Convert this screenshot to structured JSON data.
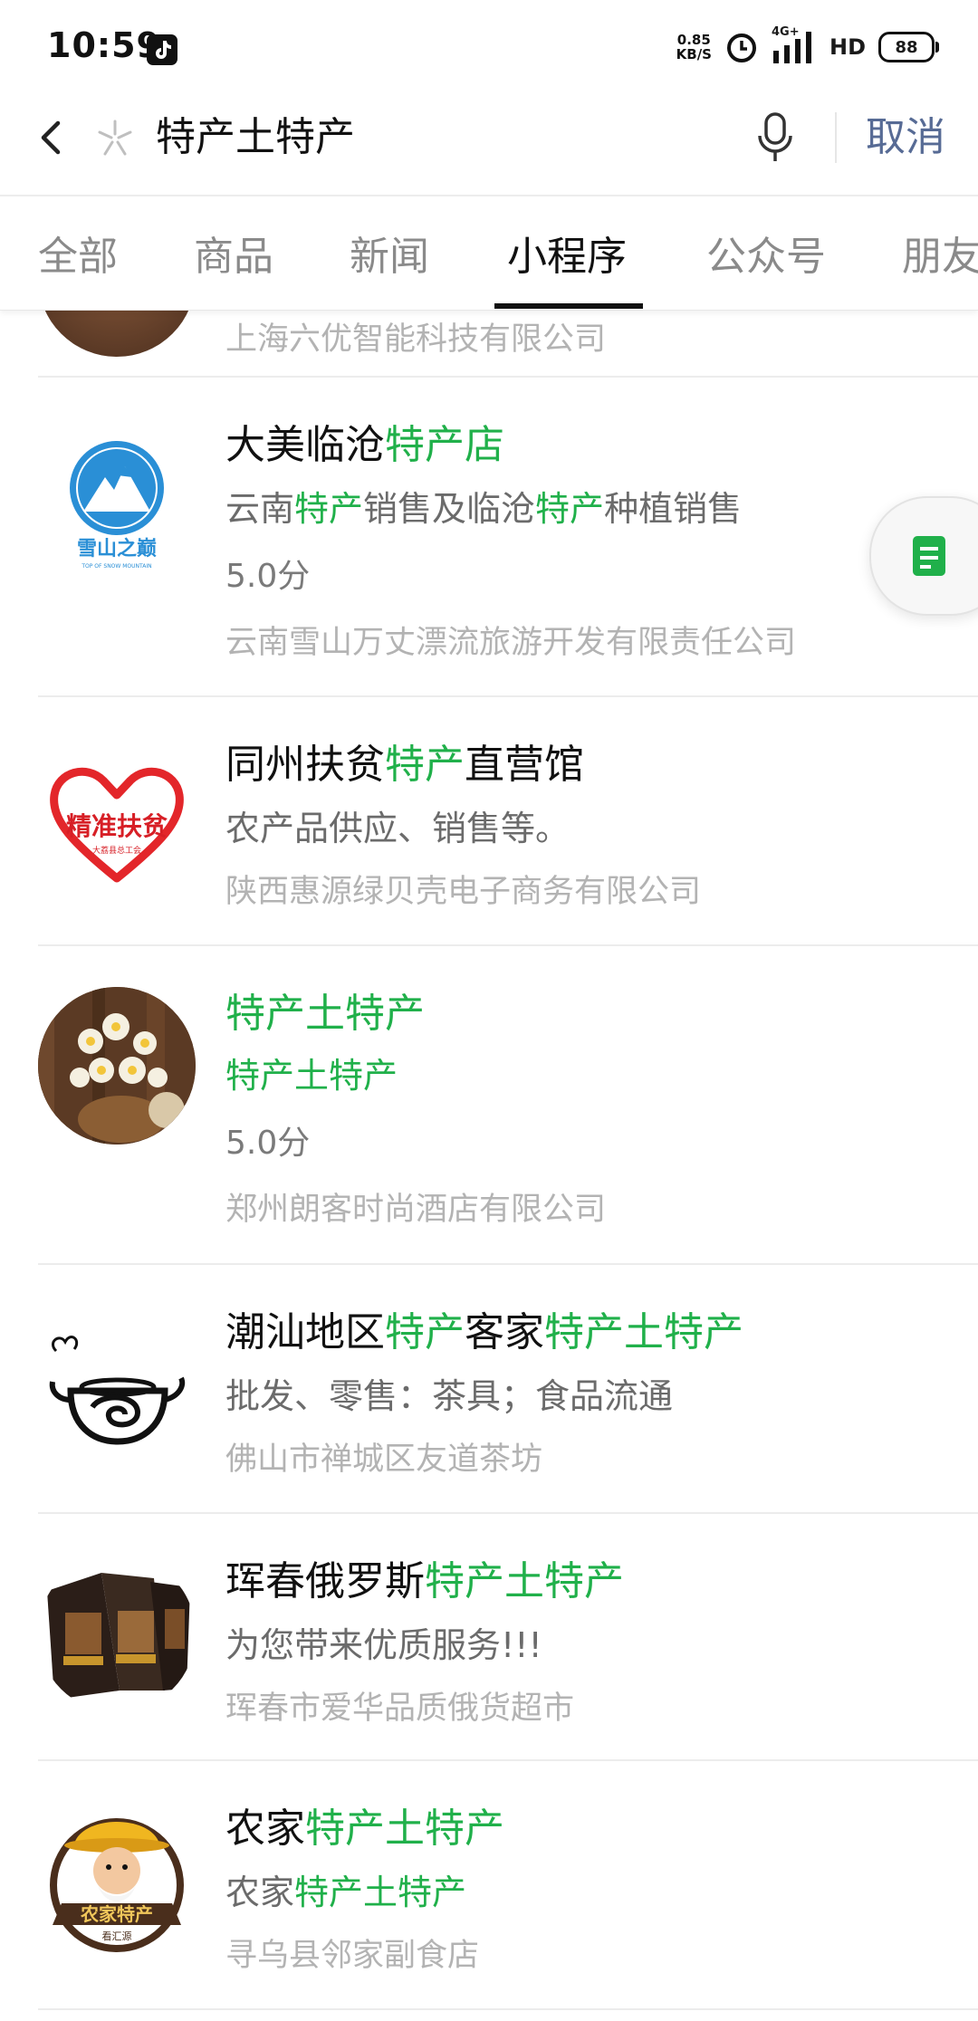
{
  "status_bar": {
    "time": "10:59",
    "net_speed_value": "0.85",
    "net_speed_unit": "KB/S",
    "network": "4G+",
    "hd": "HD",
    "battery": "88"
  },
  "search": {
    "query": "特产土特产",
    "cancel_label": "取消"
  },
  "tabs": [
    {
      "label": "全部"
    },
    {
      "label": "商品"
    },
    {
      "label": "新闻"
    },
    {
      "label": "小程序",
      "active": true
    },
    {
      "label": "公众号"
    },
    {
      "label": "朋友"
    }
  ],
  "results": [
    {
      "company": "上海六优智能科技有限公司"
    },
    {
      "title": [
        "大美临沧",
        "特产店"
      ],
      "desc": [
        "云南",
        "特产",
        "销售及临沧",
        "特产",
        "种植销售"
      ],
      "score": "5.0分",
      "company": "云南雪山万丈漂流旅游开发有限责任公司",
      "logo_text": "雪山之巅",
      "logo_subtext": "TOP OF SNOW MOUNTAIN"
    },
    {
      "title": [
        "同州扶贫",
        "特产",
        "直营馆"
      ],
      "desc": [
        "农产品供应、销售等。"
      ],
      "company": "陕西惠源绿贝壳电子商务有限公司",
      "logo_text": "精准扶贫",
      "logo_subtext": "大荔县总工会"
    },
    {
      "title": [
        "特产土特产"
      ],
      "desc": [
        "特产土特产"
      ],
      "score": "5.0分",
      "company": "郑州朗客时尚酒店有限公司"
    },
    {
      "title": [
        "潮汕地区",
        "特产",
        "客家",
        "特产土特产"
      ],
      "desc": [
        "批发、零售：茶具；食品流通"
      ],
      "company": "佛山市禅城区友道茶坊"
    },
    {
      "title": [
        "珲春俄罗斯",
        "特产土特产"
      ],
      "desc": [
        "为您带来优质服务!!!"
      ],
      "company": "珲春市爱华品质俄货超市"
    },
    {
      "title": [
        "农家",
        "特产土特产"
      ],
      "desc": [
        "农家",
        "特产土特产"
      ],
      "company": "寻乌县邻家副食店",
      "logo_text": "农家特产",
      "logo_subtext": "看汇源"
    }
  ],
  "colors": {
    "highlight": "#20b04a",
    "cancel": "#576b95",
    "title": "#111111",
    "desc": "#6b6b6b",
    "company": "#b3b3b3"
  },
  "icons": [
    "back-arrow-icon",
    "sparkle-icon",
    "microphone-icon",
    "note-icon",
    "tiktok-icon",
    "alarm-icon",
    "signal-icon"
  ]
}
